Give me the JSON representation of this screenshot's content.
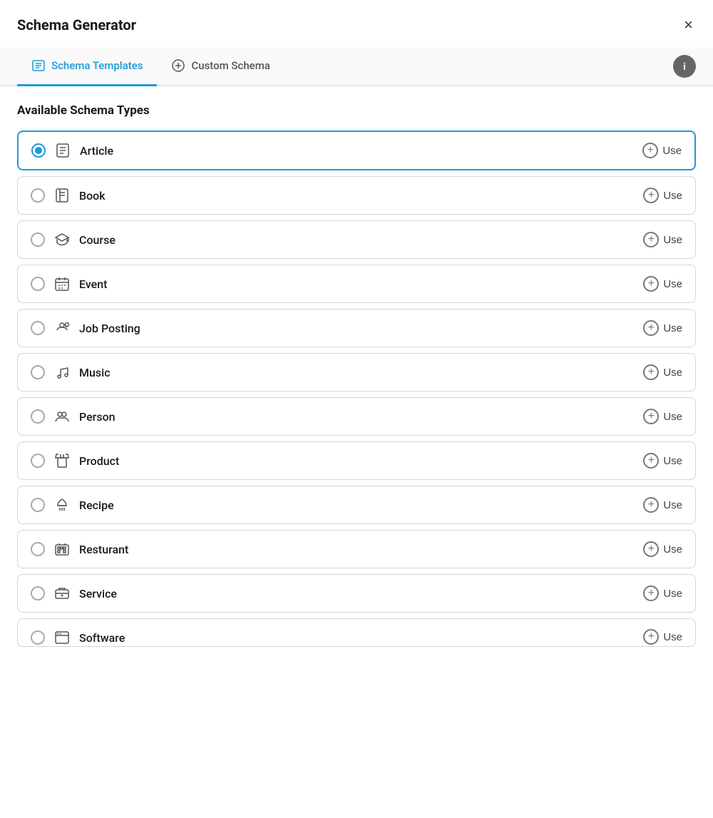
{
  "header": {
    "title": "Schema Generator",
    "close_label": "×"
  },
  "tabs": [
    {
      "id": "schema-templates",
      "label": "Schema Templates",
      "active": true
    },
    {
      "id": "custom-schema",
      "label": "Custom Schema",
      "active": false
    }
  ],
  "info_button_label": "i",
  "section_title": "Available Schema Types",
  "use_label": "Use",
  "schema_items": [
    {
      "id": "article",
      "name": "Article",
      "selected": true,
      "icon": "article"
    },
    {
      "id": "book",
      "name": "Book",
      "selected": false,
      "icon": "book"
    },
    {
      "id": "course",
      "name": "Course",
      "selected": false,
      "icon": "course"
    },
    {
      "id": "event",
      "name": "Event",
      "selected": false,
      "icon": "event"
    },
    {
      "id": "job-posting",
      "name": "Job Posting",
      "selected": false,
      "icon": "jobposting"
    },
    {
      "id": "music",
      "name": "Music",
      "selected": false,
      "icon": "music"
    },
    {
      "id": "person",
      "name": "Person",
      "selected": false,
      "icon": "person"
    },
    {
      "id": "product",
      "name": "Product",
      "selected": false,
      "icon": "product"
    },
    {
      "id": "recipe",
      "name": "Recipe",
      "selected": false,
      "icon": "recipe"
    },
    {
      "id": "resturant",
      "name": "Resturant",
      "selected": false,
      "icon": "restaurant"
    },
    {
      "id": "service",
      "name": "Service",
      "selected": false,
      "icon": "service"
    },
    {
      "id": "software",
      "name": "Software",
      "selected": false,
      "icon": "software",
      "partial": true
    }
  ]
}
